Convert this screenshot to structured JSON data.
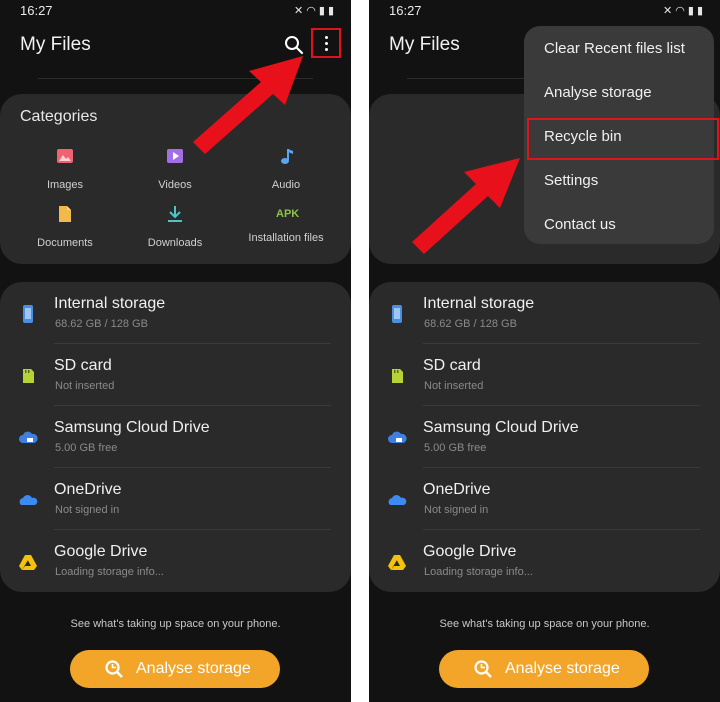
{
  "left_screen": {
    "status": {
      "time": "16:27"
    },
    "header": {
      "title": "My Files"
    },
    "categories": {
      "title": "Categories",
      "items": [
        {
          "label": "Images",
          "icon": "image-icon",
          "color": "#f06272"
        },
        {
          "label": "Videos",
          "icon": "video-icon",
          "color": "#a66ee6"
        },
        {
          "label": "Audio",
          "icon": "music-note-icon",
          "color": "#5aa6f0"
        },
        {
          "label": "Documents",
          "icon": "document-icon",
          "color": "#f2b84a"
        },
        {
          "label": "Downloads",
          "icon": "download-icon",
          "color": "#4fc3c8"
        },
        {
          "label": "Installation files",
          "icon": "apk-icon",
          "color": "#8bc34a",
          "badge": "APK"
        }
      ]
    },
    "storage": [
      {
        "name": "Internal storage",
        "sub": "68.62 GB / 128 GB",
        "icon": "phone-icon",
        "color": "#4a90e2"
      },
      {
        "name": "SD card",
        "sub": "Not inserted",
        "icon": "sd-card-icon",
        "color": "#b5d334"
      },
      {
        "name": "Samsung Cloud Drive",
        "sub": "5.00 GB free",
        "icon": "cloud-icon",
        "color": "#3f7fe0"
      },
      {
        "name": "OneDrive",
        "sub": "Not signed in",
        "icon": "onedrive-icon",
        "color": "#3d8bf2"
      },
      {
        "name": "Google Drive",
        "sub": "Loading storage info...",
        "icon": "google-drive-icon",
        "color": "#f4c20d"
      }
    ],
    "hint": "See what's taking up space on your phone.",
    "analyse_button": "Analyse storage"
  },
  "right_screen": {
    "status": {
      "time": "16:27"
    },
    "header": {
      "title": "My Files"
    },
    "menu": [
      "Clear Recent files list",
      "Analyse storage",
      "Recycle bin",
      "Settings",
      "Contact us"
    ],
    "storage": [
      {
        "name": "Internal storage",
        "sub": "68.62 GB / 128 GB"
      },
      {
        "name": "SD card",
        "sub": "Not inserted"
      },
      {
        "name": "Samsung Cloud Drive",
        "sub": "5.00 GB free"
      },
      {
        "name": "OneDrive",
        "sub": "Not signed in"
      },
      {
        "name": "Google Drive",
        "sub": "Loading storage info..."
      }
    ],
    "hint": "See what's taking up space on your phone.",
    "analyse_button": "Analyse storage"
  },
  "colors": {
    "accent": "#f3a52a",
    "highlight": "#e0121b",
    "background": "#121212",
    "card": "#2a2a2a"
  }
}
